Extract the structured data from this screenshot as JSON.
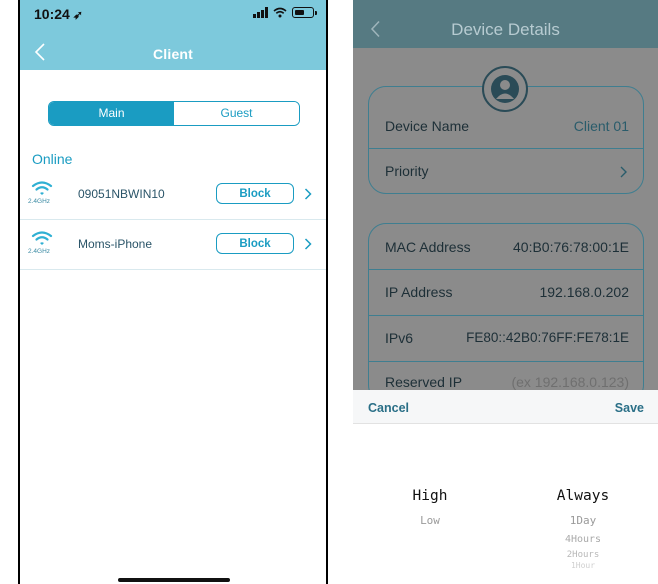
{
  "colors": {
    "header_teal": "#7dc9dc",
    "accent_blue": "#1a9cc2",
    "dim_overlay": "#8b8b8b",
    "right_header": "#567a82"
  },
  "left": {
    "status": {
      "time": "10:24",
      "location_arrow": "➶"
    },
    "header": {
      "title": "Client",
      "back_icon": "chevron-left-icon"
    },
    "tabs": [
      {
        "label": "Main",
        "selected": true
      },
      {
        "label": "Guest",
        "selected": false
      }
    ],
    "section_title": "Online",
    "clients": [
      {
        "band": "2.4GHz",
        "name": "09051NBWIN10",
        "action": "Block"
      },
      {
        "band": "2.4GHz",
        "name": "Moms-iPhone",
        "action": "Block"
      }
    ]
  },
  "right": {
    "header": {
      "title": "Device Details",
      "back_icon": "chevron-left-icon"
    },
    "card1": [
      {
        "label": "Device Name",
        "value": "Client 01"
      },
      {
        "label": "Priority",
        "value": ""
      }
    ],
    "card2": [
      {
        "label": "MAC Address",
        "value": "40:B0:76:78:00:1E"
      },
      {
        "label": "IP Address",
        "value": "192.168.0.202"
      },
      {
        "label": "IPv6",
        "value": "FE80::42B0:76FF:FE78:1E"
      },
      {
        "label": "Reserved IP",
        "placeholder": "(ex 192.168.0.123)"
      }
    ],
    "sheet": {
      "cancel": "Cancel",
      "save": "Save",
      "priority_picker": {
        "selected": "High",
        "options": [
          "Low"
        ]
      },
      "duration_picker": {
        "selected": "Always",
        "options": [
          "1Day",
          "4Hours",
          "2Hours",
          "1Hour"
        ]
      }
    }
  }
}
